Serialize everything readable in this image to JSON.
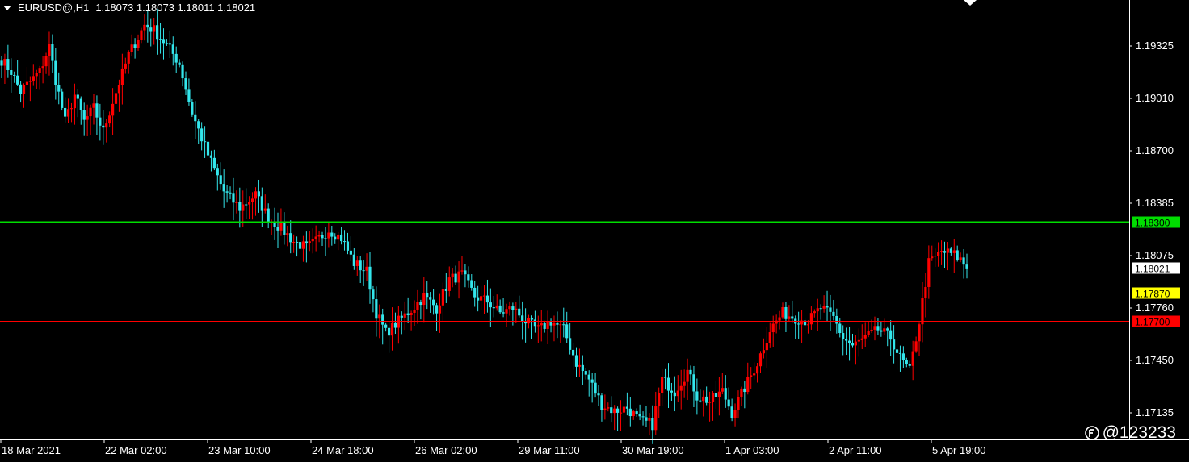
{
  "header": {
    "symbol": "EURUSD@,H1",
    "ohlc": "1.18073 1.18073 1.18011 1.18021"
  },
  "watermark": "@123233",
  "colors": {
    "background": "#000000",
    "axis": "#ffffff",
    "bull": "#ff0000",
    "bear": "#33e6ec",
    "green_line": "#00dd00",
    "yellow_line": "#ffff00",
    "red_line": "#ff0000",
    "current_line": "#ffffff"
  },
  "chart_data": {
    "type": "candlestick",
    "ylim": [
      1.1699,
      1.1963
    ],
    "price_ticks": [
      "1.19325",
      "1.19010",
      "1.18700",
      "1.18385",
      "1.18075",
      "1.17760",
      "1.17450",
      "1.17135"
    ],
    "time_ticks": [
      "18 Mar 2021",
      "22 Mar 02:00",
      "23 Mar 10:00",
      "24 Mar 18:00",
      "26 Mar 02:00",
      "29 Mar 11:00",
      "30 Mar 19:00",
      "1 Apr 03:00",
      "2 Apr 11:00",
      "5 Apr 19:00"
    ],
    "levels": [
      {
        "price": 1.183,
        "label": "1.18300",
        "color": "#00dd00",
        "label_bg": "#00dd00",
        "label_fg": "#000000"
      },
      {
        "price": 1.18021,
        "label": "1.18021",
        "color": "#ffffff",
        "label_bg": "#ffffff",
        "label_fg": "#000000"
      },
      {
        "price": 1.1787,
        "label": "1.17870",
        "color": "#ffff00",
        "label_bg": "#ffff00",
        "label_fg": "#000000"
      },
      {
        "price": 1.177,
        "label": "1.17700",
        "color": "#ff0000",
        "label_bg": "#ff0000",
        "label_fg": "#000000"
      }
    ],
    "close_path": [
      [
        0,
        1.1927
      ],
      [
        3,
        1.192
      ],
      [
        6,
        1.1908
      ],
      [
        9,
        1.1914
      ],
      [
        12,
        1.192
      ],
      [
        15,
        1.1935
      ],
      [
        17,
        1.1915
      ],
      [
        20,
        1.189
      ],
      [
        23,
        1.1906
      ],
      [
        26,
        1.189
      ],
      [
        29,
        1.1898
      ],
      [
        32,
        1.1884
      ],
      [
        35,
        1.1902
      ],
      [
        40,
        1.193
      ],
      [
        45,
        1.1948
      ],
      [
        48,
        1.1945
      ],
      [
        52,
        1.1936
      ],
      [
        56,
        1.1925
      ],
      [
        60,
        1.1895
      ],
      [
        65,
        1.187
      ],
      [
        70,
        1.1848
      ],
      [
        75,
        1.1838
      ],
      [
        80,
        1.1846
      ],
      [
        84,
        1.1832
      ],
      [
        88,
        1.1826
      ],
      [
        92,
        1.1818
      ],
      [
        96,
        1.1814
      ],
      [
        99,
        1.1818
      ],
      [
        103,
        1.1825
      ],
      [
        107,
        1.182
      ],
      [
        111,
        1.1805
      ],
      [
        115,
        1.18
      ],
      [
        118,
        1.1775
      ],
      [
        121,
        1.1763
      ],
      [
        125,
        1.177
      ],
      [
        129,
        1.1777
      ],
      [
        133,
        1.1785
      ],
      [
        137,
        1.1778
      ],
      [
        141,
        1.1795
      ],
      [
        145,
        1.1798
      ],
      [
        149,
        1.1785
      ],
      [
        153,
        1.1782
      ],
      [
        157,
        1.1775
      ],
      [
        161,
        1.1778
      ],
      [
        165,
        1.177
      ],
      [
        169,
        1.1765
      ],
      [
        173,
        1.177
      ],
      [
        177,
        1.1765
      ],
      [
        181,
        1.1745
      ],
      [
        185,
        1.1735
      ],
      [
        189,
        1.172
      ],
      [
        193,
        1.1716
      ],
      [
        197,
        1.1718
      ],
      [
        201,
        1.171
      ],
      [
        205,
        1.1708
      ],
      [
        208,
        1.1735
      ],
      [
        212,
        1.1728
      ],
      [
        216,
        1.174
      ],
      [
        219,
        1.1725
      ],
      [
        223,
        1.1722
      ],
      [
        227,
        1.1728
      ],
      [
        230,
        1.1715
      ],
      [
        234,
        1.173
      ],
      [
        238,
        1.1745
      ],
      [
        242,
        1.1765
      ],
      [
        246,
        1.1775
      ],
      [
        250,
        1.1772
      ],
      [
        254,
        1.177
      ],
      [
        258,
        1.1778
      ],
      [
        262,
        1.1772
      ],
      [
        265,
        1.176
      ],
      [
        268,
        1.1755
      ],
      [
        272,
        1.176
      ],
      [
        276,
        1.1765
      ],
      [
        280,
        1.176
      ],
      [
        283,
        1.1748
      ],
      [
        286,
        1.174
      ],
      [
        289,
        1.177
      ],
      [
        292,
        1.1805
      ],
      [
        296,
        1.1812
      ],
      [
        300,
        1.181
      ],
      [
        302,
        1.1807
      ],
      [
        304,
        1.1802
      ]
    ]
  }
}
